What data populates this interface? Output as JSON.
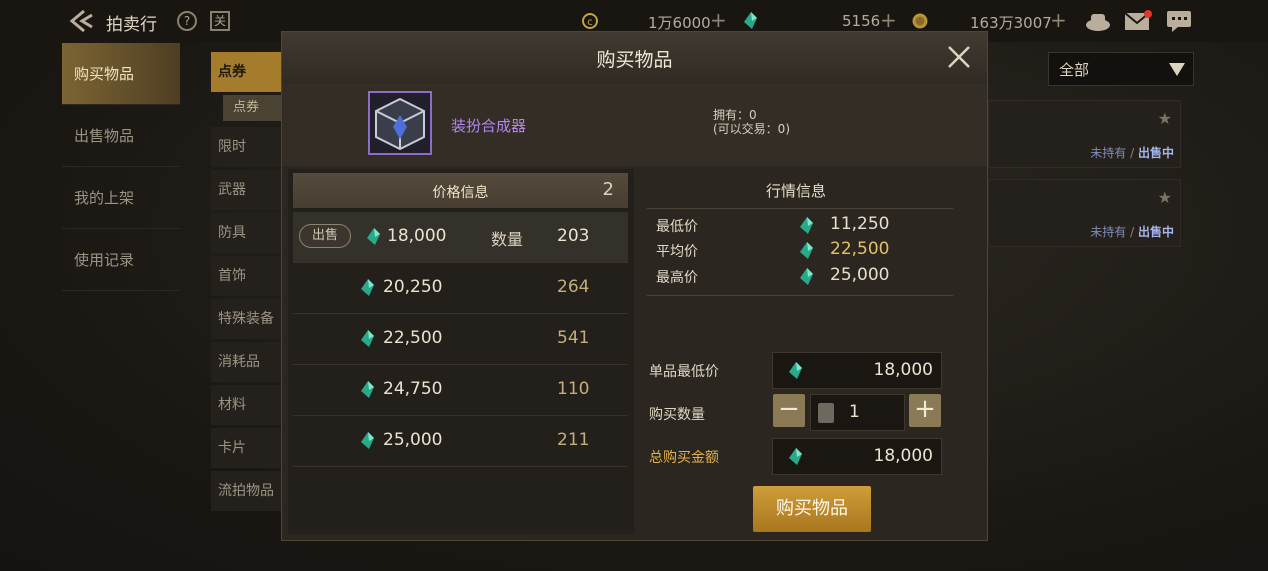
{
  "header": {
    "title": "拍卖行",
    "help_icon_text": "?",
    "calendar_icon_text": "关",
    "currency1": "1万6000",
    "currency2": "5156",
    "currency3": "163万3007",
    "plus": "+"
  },
  "nav": {
    "items": [
      {
        "label": "购买物品",
        "active": true
      },
      {
        "label": "出售物品"
      },
      {
        "label": "我的上架"
      },
      {
        "label": "使用记录"
      }
    ]
  },
  "categories": {
    "top": "点券",
    "sub": "点券",
    "items": [
      "限时",
      "武器",
      "防具",
      "首饰",
      "特殊装备",
      "消耗品",
      "材料",
      "卡片",
      "流拍物品"
    ]
  },
  "filter": {
    "selected": "全部"
  },
  "list_cards": [
    {
      "status_a": "未持有",
      "sep": " / ",
      "status_b": "出售中"
    },
    {
      "status_a": "未持有",
      "sep": " / ",
      "status_b": "出售中"
    }
  ],
  "modal": {
    "title": "购买物品",
    "item": {
      "name": "装扮合成器",
      "owned": "拥有：0",
      "tradable": "(可以交易：0)"
    },
    "price_panel": {
      "header": "价格信息",
      "count": "2",
      "sell_tag": "出售",
      "qty_label": "数量",
      "rows": [
        {
          "price": "18,000",
          "qty": "203"
        },
        {
          "price": "20,250",
          "qty": "264"
        },
        {
          "price": "22,500",
          "qty": "541"
        },
        {
          "price": "24,750",
          "qty": "110"
        },
        {
          "price": "25,000",
          "qty": "211"
        }
      ]
    },
    "market": {
      "title": "行情信息",
      "min_label": "最低价",
      "min_value": "11,250",
      "avg_label": "平均价",
      "avg_value": "22,500",
      "max_label": "最高价",
      "max_value": "25,000"
    },
    "form": {
      "unit_label": "单品最低价",
      "unit_value": "18,000",
      "qty_label": "购买数量",
      "qty_value": "1",
      "minus": "−",
      "plus": "+",
      "total_label": "总购买金额",
      "total_value": "18,000"
    },
    "buy_button": "购买物品"
  },
  "colors": {
    "accent_gold": "#a47c2c",
    "item_purple": "#b187f0",
    "avg_price": "#e3c16b",
    "total_label": "#e3b24a",
    "status_owned": "#7f8db8",
    "status_selling": "#a6b4ea"
  }
}
